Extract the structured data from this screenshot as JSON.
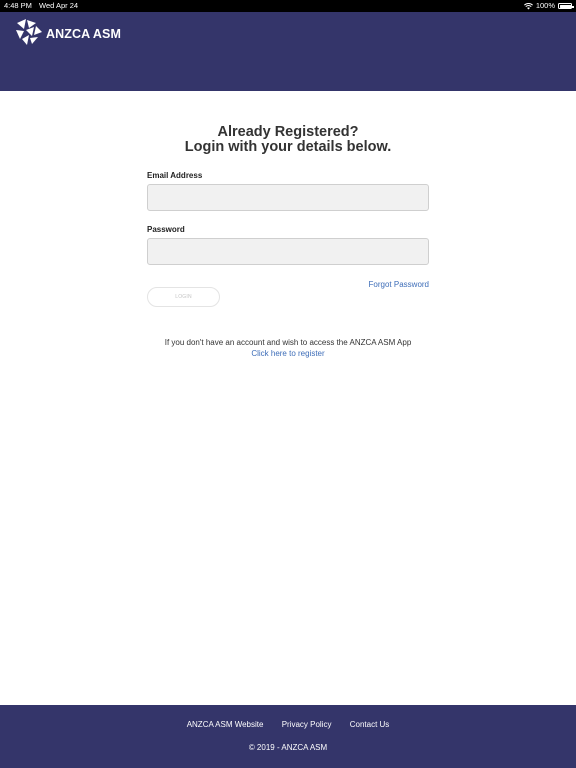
{
  "status_bar": {
    "time": "4:48 PM",
    "date": "Wed Apr 24",
    "battery": "100%"
  },
  "header": {
    "logo_text": "ANZCA ASM"
  },
  "login": {
    "heading_line1": "Already Registered?",
    "heading_line2": "Login with your details below.",
    "email_label": "Email Address",
    "email_value": "",
    "password_label": "Password",
    "password_value": "",
    "forgot_password": "Forgot Password",
    "login_button": "LOGIN"
  },
  "register": {
    "text": "If you don't have an account and wish to access the ANZCA ASM App",
    "link": "Click here to register"
  },
  "footer": {
    "links": [
      "ANZCA ASM Website",
      "Privacy Policy",
      "Contact Us"
    ],
    "copyright": "© 2019 - ANZCA ASM"
  },
  "colors": {
    "brand": "#34356a",
    "link": "#3d6db8"
  },
  "icons": {
    "wifi": "wifi-icon",
    "battery": "battery-icon",
    "logo": "anzca-logo-icon"
  }
}
